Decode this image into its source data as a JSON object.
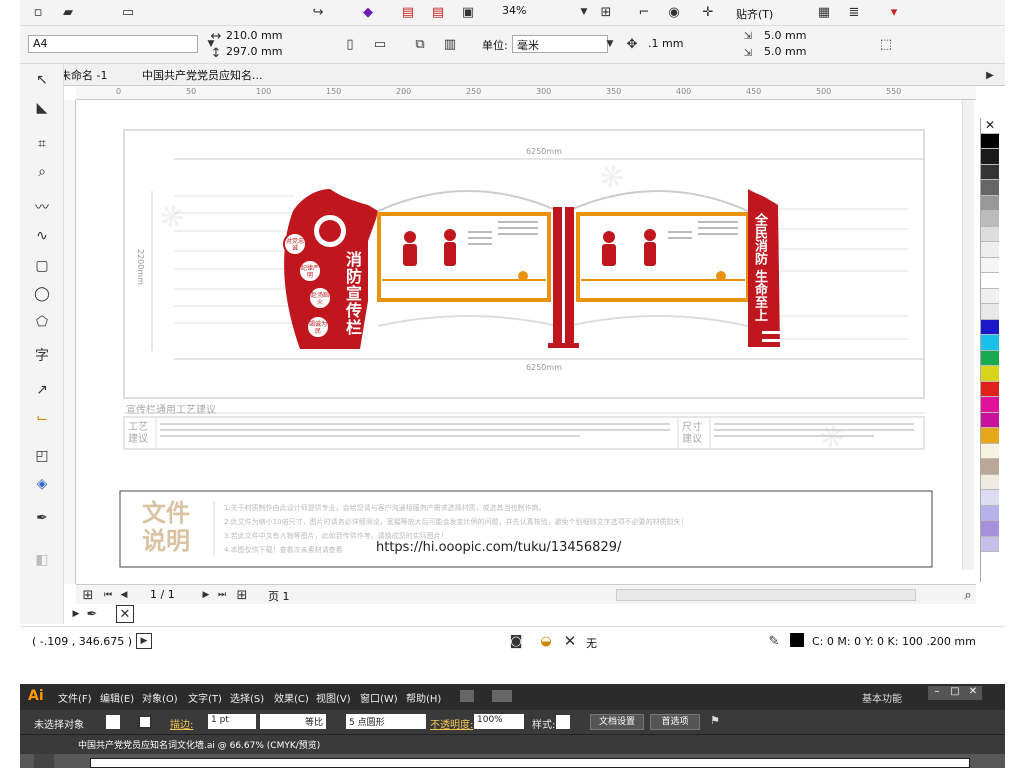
{
  "app": {
    "toolbar": {
      "zoom": "34%",
      "snap": "贴齐(T)",
      "page_size": "A4",
      "width": "210.0 mm",
      "height": "297.0 mm",
      "unit_label": "单位:",
      "unit": "毫米",
      "nudge": ".1 mm",
      "dup_x": "5.0 mm",
      "dup_y": "5.0 mm"
    },
    "tabs": [
      "未命名 -1",
      "中国共产党党员应知名..."
    ],
    "ruler_ticks": [
      "0",
      "50",
      "100",
      "150",
      "200",
      "250",
      "300",
      "350",
      "400",
      "450",
      "500",
      "550"
    ],
    "pager": {
      "count": "1 / 1",
      "page_tab": "页 1"
    },
    "status": {
      "coords": "( -.109 , 346.675 )",
      "fill_none": "无",
      "stroke": "C: 0 M: 0 Y: 0 K: 100  .200 mm"
    },
    "palette": [
      "#ffffff",
      "#000000",
      "#1a1a1a",
      "#333333",
      "#666666",
      "#999999",
      "#bbbbbb",
      "#dddddd",
      "#eeeeee",
      "#f5f5f5",
      "#ffffff",
      "#f0f0f0",
      "#e8e8e8",
      "#1a18c8",
      "#19c0e8",
      "#19a94e",
      "#d7d61c",
      "#e0201a",
      "#e0119a",
      "#c8129a",
      "#e5a81a",
      "#f7f2e2",
      "#bba698",
      "#f0eae0",
      "#dcdcf2",
      "#b8b0e8",
      "#a690dc",
      "#c8c0ec"
    ]
  },
  "design": {
    "dim_top": "6250mm",
    "dim_bottom": "6250mm",
    "dim_side": "2200mm",
    "title_main": "消防宣传栏",
    "title_right": "全民消防 生命至上",
    "badges": [
      "对党忠诚",
      "纪律严明",
      "赴汤蹈火",
      "竭诚为民"
    ],
    "craft_title": "宣传栏通用工艺建议",
    "craft_left": "工艺建议",
    "craft_right": "尺寸建议",
    "note_title": "文件说明",
    "note_lines": [
      "1.关于材质制作由此设计师提供专业，会给您请与客户沟通相服务产需求选择材质，或选其当也制作商。",
      "2.此文件为缩小10倍尺寸，图片时请务必详细测设，宽幅等放大后可能会发变比例的问题，并先认真核验，避免个别细则文字选项不必要的材质损失！",
      "3.若此文件中文有人物等图片，此如到传供作考，请换成您的实际图片！",
      "4.本图仅供下载！查看次未素材请查看"
    ],
    "url": "https://hi.ooopic.com/tuku/13456829/"
  },
  "ai": {
    "logo": "Ai",
    "menus": [
      "文件(F)",
      "编辑(E)",
      "对象(O)",
      "文字(T)",
      "选择(S)",
      "效果(C)",
      "视图(V)",
      "窗口(W)",
      "帮助(H)"
    ],
    "workspace": "基本功能",
    "no_selection": "未选择对象",
    "stroke_label": "描边:",
    "stroke_value": "1 pt",
    "stroke_style": "等比",
    "brush": "5 点圆形",
    "opacity_label": "不透明度:",
    "opacity": "100%",
    "style_label": "样式:",
    "doc_settings": "文档设置",
    "prefs": "首选项",
    "doc_tab": "中国共产党党员应知名词文化墙.ai @ 66.67% (CMYK/预览)"
  }
}
